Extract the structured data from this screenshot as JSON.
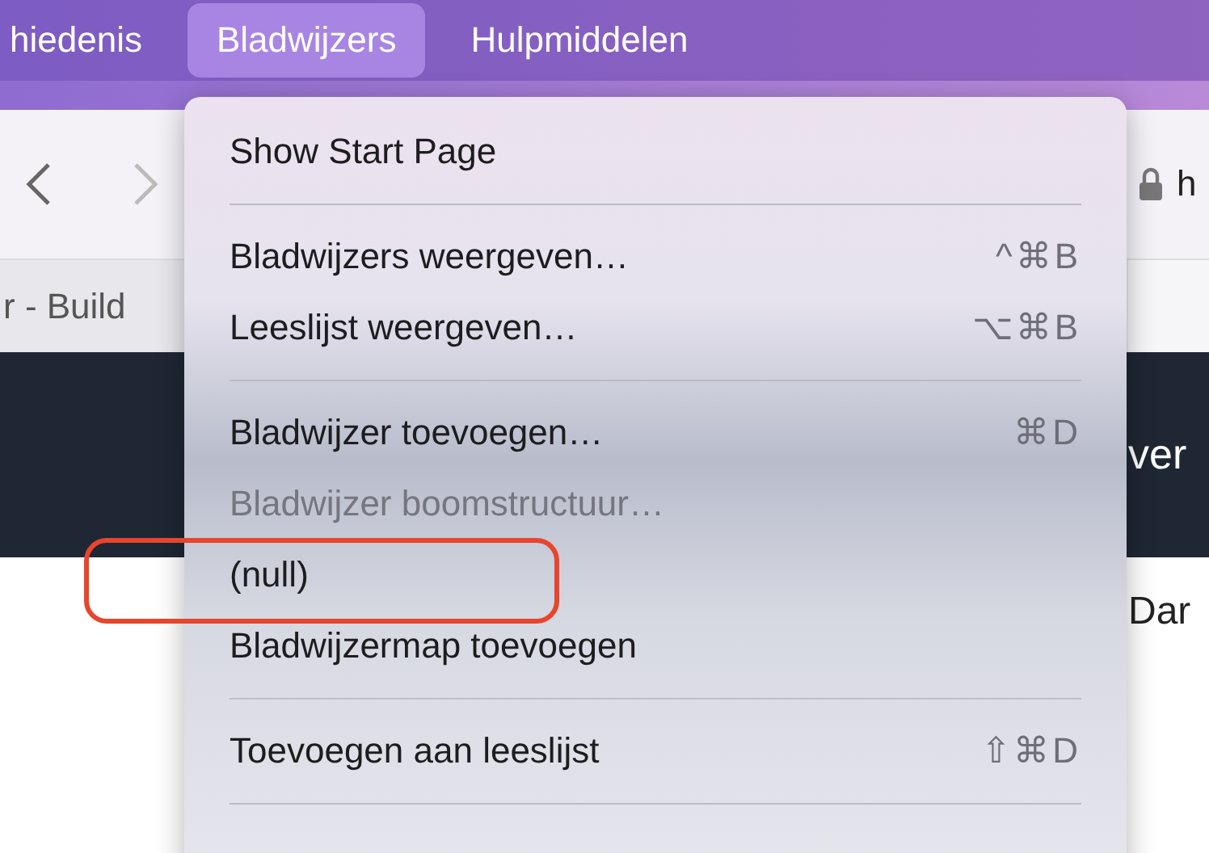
{
  "menu_bar": [
    {
      "label": "hiedenis",
      "selected": false
    },
    {
      "label": "Bladwijzers",
      "selected": true
    },
    {
      "label": "Hulpmiddelen",
      "selected": false
    }
  ],
  "browser": {
    "tab_title": "r - Build",
    "address": "h",
    "banner_text": "ver",
    "content_text": "Dar"
  },
  "menu": [
    {
      "kind": "item",
      "label": "Show Start Page",
      "disabled": false
    },
    {
      "kind": "separator"
    },
    {
      "kind": "item",
      "label": "Bladwijzers weergeven…",
      "shortcut": "^⌘B",
      "disabled": false
    },
    {
      "kind": "item",
      "label": "Leeslijst weergeven…",
      "shortcut": "⌥⌘B",
      "disabled": false
    },
    {
      "kind": "separator"
    },
    {
      "kind": "item",
      "label": "Bladwijzer toevoegen…",
      "shortcut": "⌘D",
      "disabled": false
    },
    {
      "kind": "item",
      "label": "Bladwijzer boomstructuur…",
      "disabled": true
    },
    {
      "kind": "item",
      "label": "(null)",
      "disabled": false,
      "annotated": true
    },
    {
      "kind": "item",
      "label": "Bladwijzermap toevoegen",
      "disabled": false
    },
    {
      "kind": "separator"
    },
    {
      "kind": "item",
      "label": "Toevoegen aan leeslijst",
      "shortcut": "⇧⌘D",
      "disabled": false
    },
    {
      "kind": "separator"
    }
  ]
}
